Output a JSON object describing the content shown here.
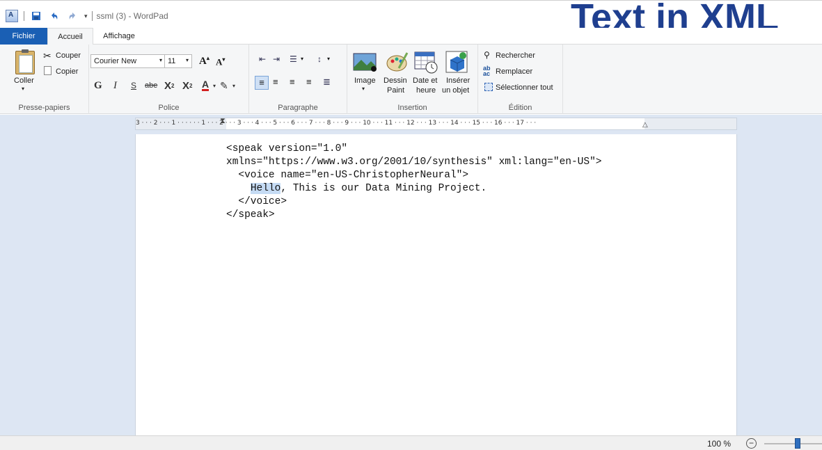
{
  "window": {
    "title": "ssml (3) - WordPad",
    "overlay_heading": "Text in XML"
  },
  "tabs": {
    "fichier": "Fichier",
    "accueil": "Accueil",
    "affichage": "Affichage"
  },
  "ribbon": {
    "clipboard": {
      "label": "Presse-papiers",
      "paste": "Coller",
      "cut": "Couper",
      "copy": "Copier"
    },
    "font": {
      "label": "Police",
      "family": "Courier New",
      "size": "11",
      "bold": "G",
      "italic": "I",
      "underline": "S",
      "strike": "abe"
    },
    "paragraph": {
      "label": "Paragraphe"
    },
    "insert": {
      "label": "Insertion",
      "image": "Image",
      "paint_line1": "Dessin",
      "paint_line2": "Paint",
      "datetime_line1": "Date et",
      "datetime_line2": "heure",
      "object_line1": "Insérer",
      "object_line2": "un objet"
    },
    "edit": {
      "label": "Édition",
      "find": "Rechercher",
      "replace": "Remplacer",
      "select_all": "Sélectionner tout"
    }
  },
  "ruler": {
    "ticks": "3 · · · 2 · · · 1 · · ·  · · · 1 · · · 2 · · · 3 · · · 4 · · · 5 · · · 6 · · · 7 · · · 8 · · · 9 · · · 10 · · · 11 · · · 12 · · · 13 · · · 14 · · · 15 · · · 16 · · · 17 · · ·"
  },
  "document": {
    "line1": "<speak version=\"1.0\"",
    "line2": "xmlns=\"https://www.w3.org/2001/10/synthesis\" xml:lang=\"en-US\">",
    "line3": "  <voice name=\"en-US-ChristopherNeural\">",
    "line4_selected": "Hello",
    "line4_rest": ", This is our Data Mining Project.",
    "line5": "  </voice>",
    "line6": "</speak>"
  },
  "status": {
    "zoom": "100 %",
    "zoom_out": "−"
  },
  "colors": {
    "accent": "#1a5fb4",
    "heading": "#1f3f8f",
    "selection": "#c5dbf4",
    "workspace": "#dde6f3"
  }
}
